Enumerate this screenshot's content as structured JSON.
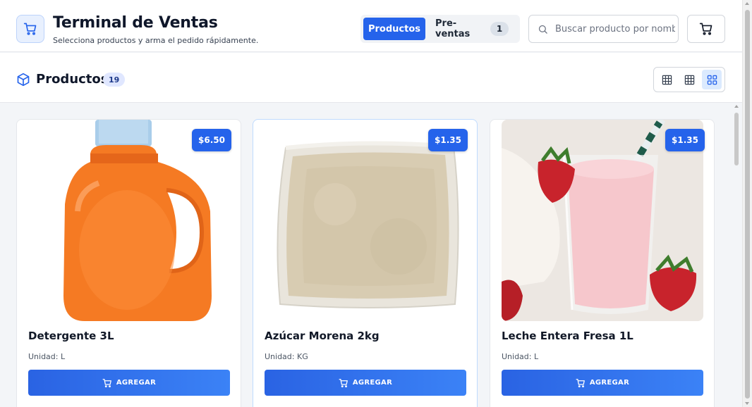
{
  "app": {
    "title": "Terminal de Ventas",
    "subtitle": "Selecciona productos y arma el pedido rápidamente.",
    "logo_icon": "cart-icon"
  },
  "tabs": [
    {
      "label": "Productos",
      "active": true
    },
    {
      "label": "Pre-ventas",
      "active": false,
      "count": "1"
    }
  ],
  "search": {
    "placeholder": "Buscar producto por nombre",
    "value": ""
  },
  "header_cart_icon": "cart-icon",
  "section": {
    "title": "Productos",
    "count": "19",
    "icon": "box-icon",
    "view_options": [
      "grid-small-icon",
      "grid-medium-icon",
      "grid-large-icon"
    ],
    "active_view": "grid-large-icon"
  },
  "products": [
    {
      "name": "Detergente 3L",
      "price": "$6.50",
      "unit": "Unidad: L",
      "button": "AGREGAR",
      "image": "detergent-bottle"
    },
    {
      "name": "Azúcar Morena 2kg",
      "price": "$1.35",
      "unit": "Unidad: KG",
      "button": "AGREGAR",
      "image": "sugar-bag"
    },
    {
      "name": "Leche Entera Fresa 1L",
      "price": "$1.35",
      "unit": "Unidad: L",
      "button": "AGREGAR",
      "image": "strawberry-milk"
    }
  ],
  "colors": {
    "accent": "#2563eb",
    "background": "#f3f5f8",
    "badge_bg": "#e0e7ff"
  }
}
